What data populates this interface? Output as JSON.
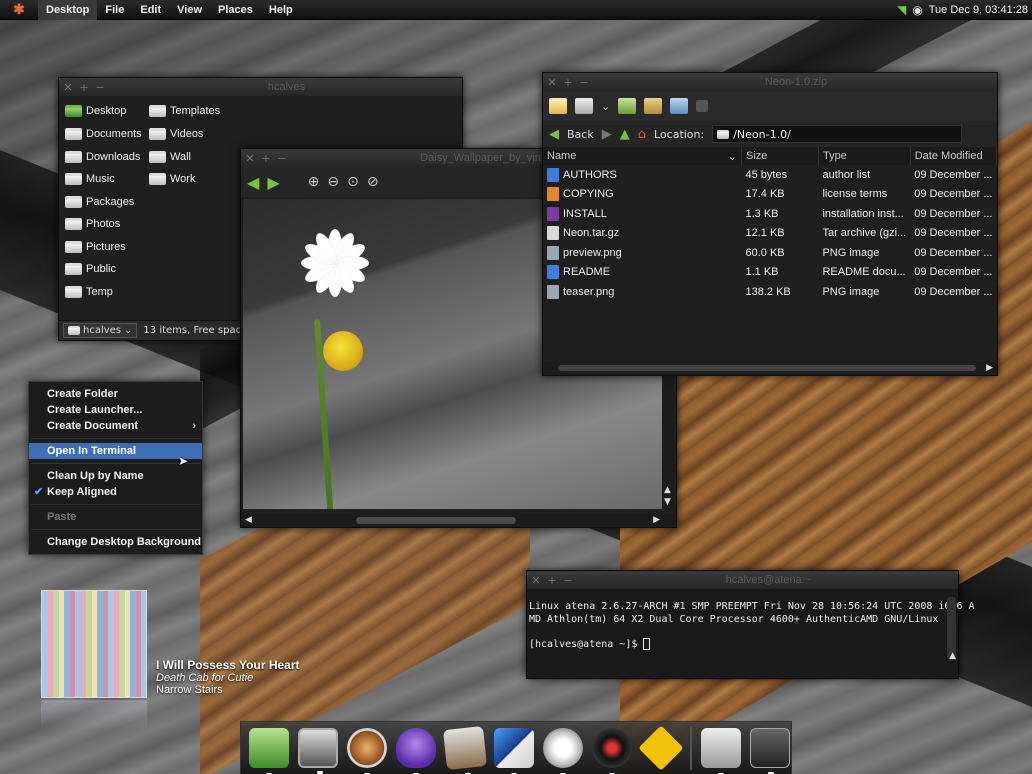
{
  "top_panel": {
    "logo": "✱",
    "menus": [
      "Desktop",
      "File",
      "Edit",
      "View",
      "Places",
      "Help"
    ],
    "clock": "Tue Dec  9, 03:41:28"
  },
  "home_window": {
    "title": "hcalves",
    "items": [
      "Desktop",
      "Documents",
      "Downloads",
      "Music",
      "Packages",
      "Photos",
      "Pictures",
      "Public",
      "Temp",
      "Templates",
      "Videos",
      "Wall",
      "Work"
    ],
    "location_combo": "hcalves",
    "status": "13 items, Free space: 20.5 GB"
  },
  "image_window": {
    "title": "Daisy_Wallpaper_by_vinyl"
  },
  "archive_window": {
    "title": "Neon-1.0.zip",
    "back_label": "Back",
    "location_label": "Location:",
    "location_value": "/Neon-1.0/",
    "columns": [
      "Name",
      "Size",
      "Type",
      "Date Modified"
    ],
    "rows": [
      {
        "name": "AUTHORS",
        "size": "45 bytes",
        "type": "author list",
        "date": "09 December ...",
        "color": "#3d7fd6"
      },
      {
        "name": "COPYING",
        "size": "17.4 KB",
        "type": "license terms",
        "date": "09 December ...",
        "color": "#e08a2a"
      },
      {
        "name": "INSTALL",
        "size": "1.3 KB",
        "type": "installation inst...",
        "date": "09 December ...",
        "color": "#7b3ca0"
      },
      {
        "name": "Neon.tar.gz",
        "size": "12.1 KB",
        "type": "Tar archive (gzi...",
        "date": "09 December ...",
        "color": "#d8d8d8"
      },
      {
        "name": "preview.png",
        "size": "60.0 KB",
        "type": "PNG image",
        "date": "09 December ...",
        "color": "#9aa7b3"
      },
      {
        "name": "README",
        "size": "1.1 KB",
        "type": "README docu...",
        "date": "09 December ...",
        "color": "#3d7fd6"
      },
      {
        "name": "teaser.png",
        "size": "138.2 KB",
        "type": "PNG image",
        "date": "09 December ...",
        "color": "#9aa7b3"
      }
    ]
  },
  "context_menu": {
    "items": [
      "Create Folder",
      "Create Launcher...",
      "Create Document",
      "Open In Terminal",
      "Clean Up by Name",
      "Keep Aligned",
      "Paste",
      "Change Desktop Background"
    ]
  },
  "terminal": {
    "title": "hcalves@atena:~",
    "line1": "Linux atena 2.6.27-ARCH #1 SMP PREEMPT Fri Nov 28 10:56:24 UTC 2008 i686 A",
    "line2": "MD Athlon(tm) 64 X2 Dual Core Processor 4600+ AuthenticAMD GNU/Linux",
    "prompt": "[hcalves@atena ~]$ "
  },
  "music": {
    "title": "I Will Possess Your Heart",
    "artist": "Death Cab for Cutie",
    "album": "Narrow Stairs"
  }
}
